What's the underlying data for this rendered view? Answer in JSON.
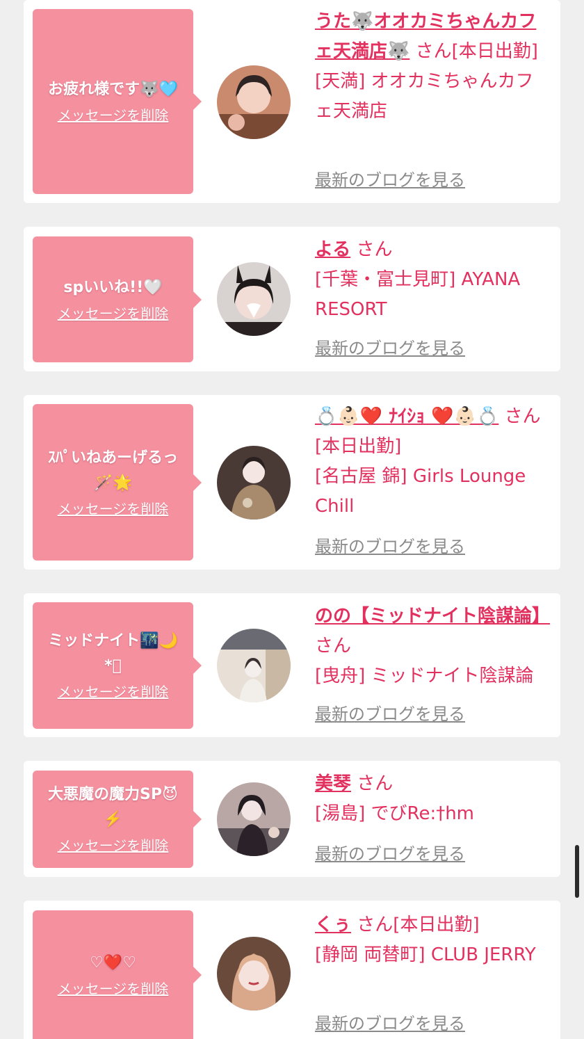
{
  "delete_label": "メッセージを削除",
  "blog_label": "最新のブログを見る",
  "san_suffix": "さん",
  "colors": {
    "page_bg": "#efefef",
    "card_bg": "#ffffff",
    "bubble_bg": "#f5909f",
    "accent": "#e2315f",
    "link_gray": "#8a8a8a"
  },
  "items": [
    {
      "message": "お疲れ様です🐺🩵",
      "cast_name": "うた🐺オオカミちゃんカフェ天満店🐺",
      "status": "[本日出勤]",
      "shop": "[天満] オオカミちゃんカフェ天満店",
      "avatar_icon": "avatar-photo-icon"
    },
    {
      "message": "spいいね!!🤍",
      "cast_name": "よる",
      "status": "",
      "shop": "[千葉・富士見町] AYANA RESORT",
      "avatar_icon": "avatar-photo-icon"
    },
    {
      "message": "ｽﾊﾟいねあーげるっ🪄🌟",
      "cast_name": "💍👶🏻❤️ ﾅｲｼｮ ❤️👶🏻💍",
      "status": "[本日出勤]",
      "shop": "[名古屋 錦] Girls Lounge Chill",
      "avatar_icon": "avatar-photo-icon"
    },
    {
      "message": "ミッドナイト🌃🌙*ﾟ",
      "cast_name": "のの【ミッドナイト陰謀論】",
      "status": "",
      "shop": "[曳舟] ミッドナイト陰謀論",
      "avatar_icon": "avatar-photo-icon"
    },
    {
      "message": "大悪魔の魔力SP😈⚡️",
      "cast_name": "美琴",
      "status": "",
      "shop": "[湯島] でびRe:†hm",
      "avatar_icon": "avatar-photo-icon"
    },
    {
      "message": "♡❤️♡",
      "cast_name": "くぅ",
      "status": "[本日出勤]",
      "shop": "[静岡 両替町] CLUB JERRY",
      "avatar_icon": "avatar-photo-icon"
    }
  ]
}
